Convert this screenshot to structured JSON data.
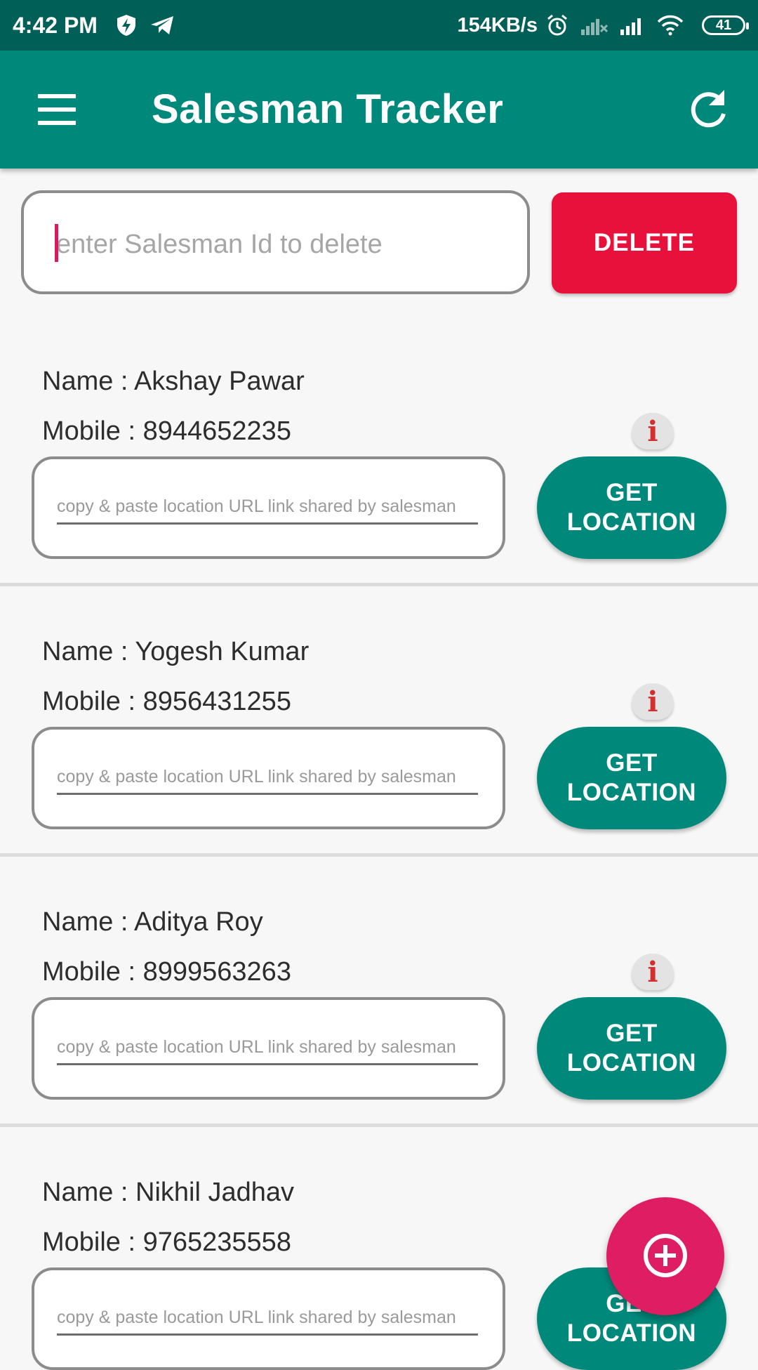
{
  "status_bar": {
    "time": "4:42 PM",
    "network_speed": "154KB/s",
    "battery": "41",
    "icons": [
      "shield-bolt-icon",
      "telegram-icon",
      "alarm-icon",
      "signal-no-service-icon",
      "signal-icon",
      "wifi-icon",
      "battery-icon"
    ]
  },
  "app_bar": {
    "title": "Salesman Tracker",
    "menu_icon": "hamburger-menu-icon",
    "refresh_icon": "refresh-icon",
    "color": "#00897b"
  },
  "delete_section": {
    "placeholder": "enter Salesman Id to delete",
    "button_label": "DELETE",
    "button_color": "#e8113c"
  },
  "salesmen": [
    {
      "name": "Name : Akshay Pawar",
      "mobile": "Mobile : 8944652235",
      "info": "i",
      "url_placeholder": "copy & paste location URL link shared by salesman",
      "button_line1": "GET",
      "button_line2": "LOCATION"
    },
    {
      "name": "Name : Yogesh Kumar",
      "mobile": "Mobile : 8956431255",
      "info": "i",
      "url_placeholder": "copy & paste location URL link shared by salesman",
      "button_line1": "GET",
      "button_line2": "LOCATION"
    },
    {
      "name": "Name : Aditya Roy",
      "mobile": "Mobile : 8999563263",
      "info": "i",
      "url_placeholder": "copy & paste location URL link shared by salesman",
      "button_line1": "GET",
      "button_line2": "LOCATION"
    },
    {
      "name": "Name : Nikhil Jadhav",
      "mobile": "Mobile : 9765235558",
      "info": "i",
      "url_placeholder": "copy & paste location URL link shared by salesman",
      "button_line1": "GET",
      "button_line2": "LOCATION"
    }
  ],
  "fab": {
    "icon": "add-circle-icon",
    "color": "#de1d63"
  }
}
